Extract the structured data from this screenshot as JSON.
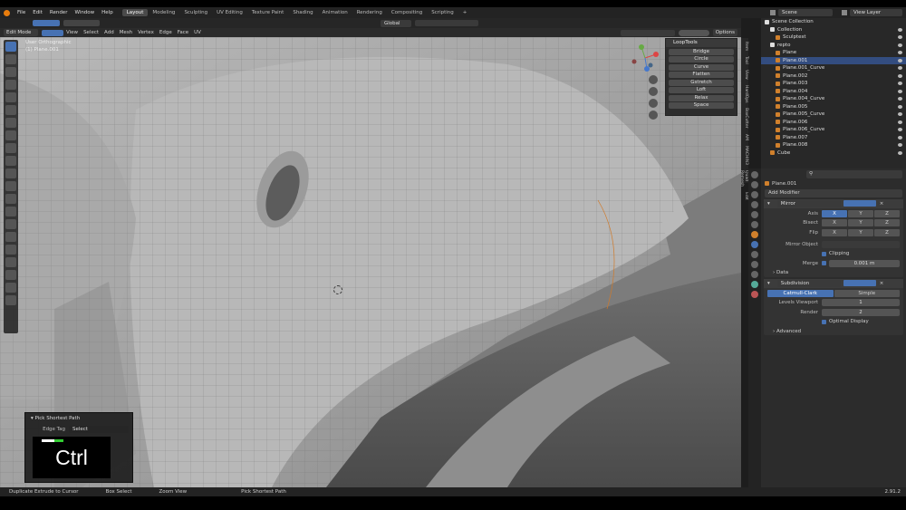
{
  "menu": [
    "File",
    "Edit",
    "Render",
    "Window",
    "Help"
  ],
  "workspaces": [
    "Layout",
    "Modeling",
    "Sculpting",
    "UV Editing",
    "Texture Paint",
    "Shading",
    "Animation",
    "Rendering",
    "Compositing",
    "Scripting",
    "+"
  ],
  "scene_field": "Scene",
  "viewlayer_field": "View Layer",
  "mode": "Edit Mode",
  "hdr_menu": [
    "View",
    "Select",
    "Add",
    "Mesh",
    "Vertex",
    "Edge",
    "Face",
    "UV"
  ],
  "orientation": "Global",
  "options": "Options",
  "viewport_title": "User Orthographic",
  "viewport_object": "(1) Plane.001",
  "looptools": {
    "title": "LoopTools",
    "items": [
      "Bridge",
      "Circle",
      "Curve",
      "Flatten",
      "Gstretch",
      "Loft",
      "Relax",
      "Space"
    ]
  },
  "sidetabs": [
    "Item",
    "Tool",
    "View",
    "HardOps",
    "BoxCutter",
    "AM",
    "MACHIN3",
    "Quad Remesh",
    "Edit"
  ],
  "outliner": {
    "root": "Scene Collection",
    "items": [
      {
        "name": "Collection",
        "indent": 1
      },
      {
        "name": "Sculptest",
        "indent": 2
      },
      {
        "name": "repto",
        "indent": 1
      },
      {
        "name": "Plane",
        "indent": 2
      },
      {
        "name": "Plane.001",
        "indent": 2,
        "selected": true
      },
      {
        "name": "Plane.001_Curve",
        "indent": 2
      },
      {
        "name": "Plane.002",
        "indent": 2
      },
      {
        "name": "Plane.003",
        "indent": 2
      },
      {
        "name": "Plane.004",
        "indent": 2
      },
      {
        "name": "Plane.004_Curve",
        "indent": 2
      },
      {
        "name": "Plane.005",
        "indent": 2
      },
      {
        "name": "Plane.005_Curve",
        "indent": 2
      },
      {
        "name": "Plane.006",
        "indent": 2
      },
      {
        "name": "Plane.006_Curve",
        "indent": 2
      },
      {
        "name": "Plane.007",
        "indent": 2
      },
      {
        "name": "Plane.008",
        "indent": 2
      },
      {
        "name": "Cube",
        "indent": 1
      }
    ]
  },
  "props": {
    "object": "Plane.001",
    "add_modifier": "Add Modifier",
    "mirror": {
      "name": "Mirror",
      "axis_label": "Axis",
      "bisect_label": "Bisect",
      "flip_label": "Flip",
      "x": "X",
      "y": "Y",
      "z": "Z",
      "mirror_object": "Mirror Object",
      "clipping": "Clipping",
      "merge_label": "Merge",
      "merge_value": "0.001 m",
      "data": "Data"
    },
    "subsurf": {
      "name": "Subdivision",
      "catmull": "Catmull-Clark",
      "simple": "Simple",
      "levels_label": "Levels Viewport",
      "levels": "1",
      "render_label": "Render",
      "render": "2",
      "optimal": "Optimal Display",
      "advanced": "Advanced"
    }
  },
  "panel": {
    "title": "Pick Shortest Path",
    "edge_tag_label": "Edge Tag",
    "edge_tag_value": "Select"
  },
  "key_overlay": "Ctrl",
  "status": [
    "Duplicate Extrude to Cursor",
    "Box Select",
    "Zoom View",
    "Pick Shortest Path"
  ],
  "version": "2.91.2"
}
